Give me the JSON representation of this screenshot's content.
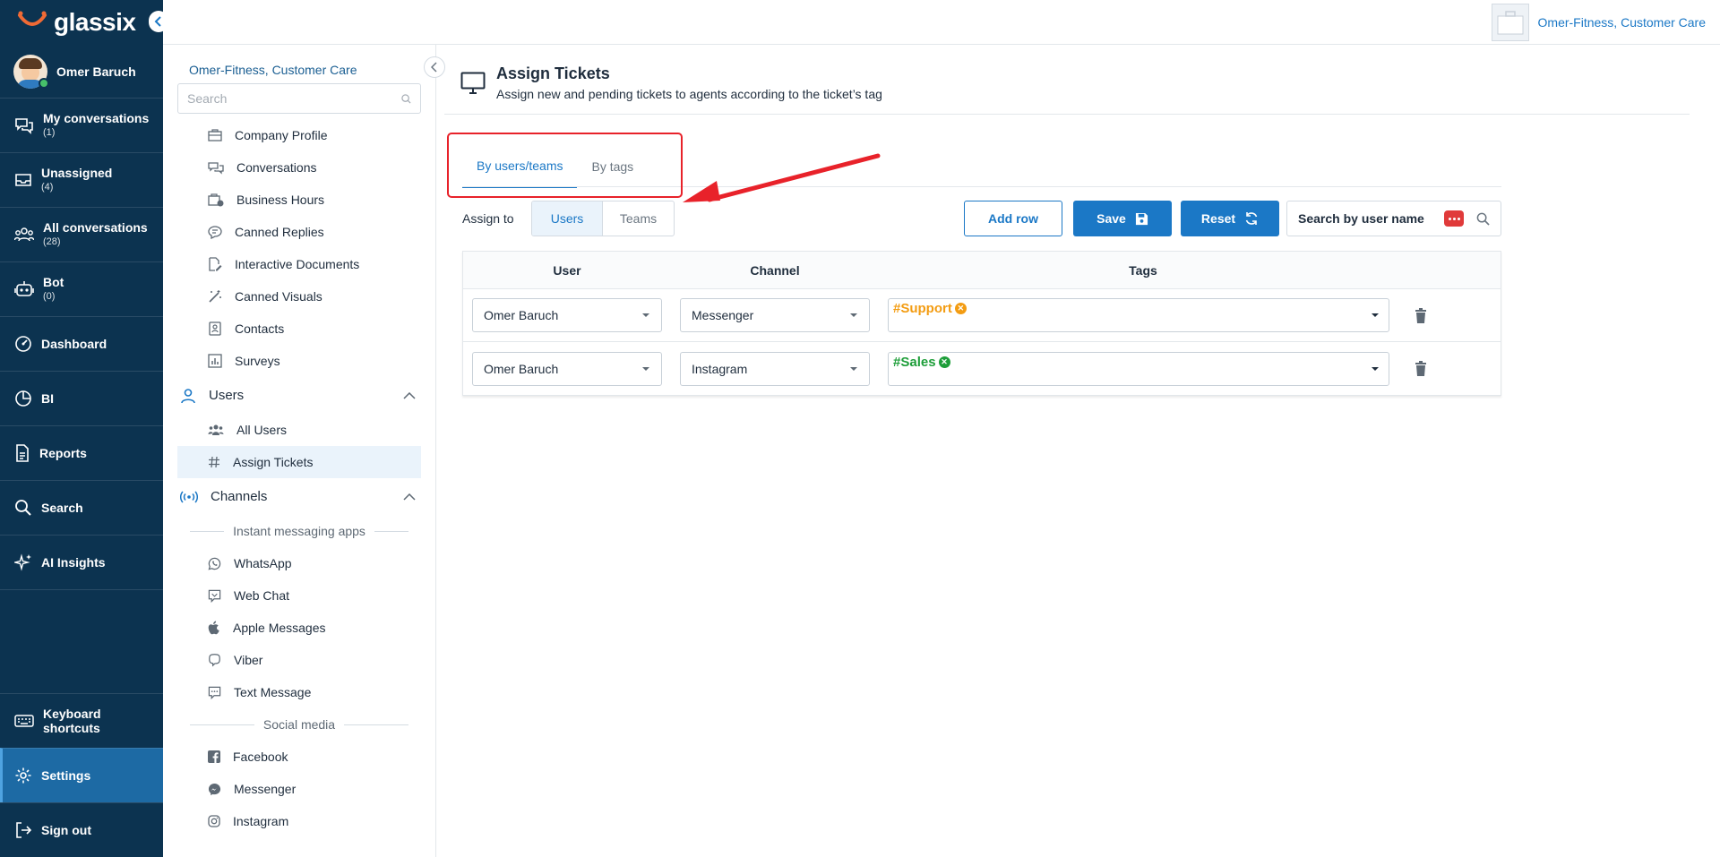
{
  "app": {
    "brand": "glassix"
  },
  "colors": {
    "nav_bg": "#0c3350",
    "accent": "#1b78c6",
    "support_tag": "#f39c12",
    "sales_tag": "#1e9e3a",
    "highlight": "#e8222a"
  },
  "profile": {
    "name": "Omer Baruch"
  },
  "nav": {
    "items": [
      {
        "label": "My conversations",
        "count": "(1)",
        "icon": "chat-bubbles-icon"
      },
      {
        "label": "Unassigned",
        "count": "(4)",
        "icon": "inbox-icon"
      },
      {
        "label": "All conversations",
        "count": "(28)",
        "icon": "group-icon"
      },
      {
        "label": "Bot",
        "count": "(0)",
        "icon": "robot-icon"
      },
      {
        "label": "Dashboard",
        "count": "",
        "icon": "dashboard-icon"
      },
      {
        "label": "BI",
        "count": "",
        "icon": "pie-chart-icon"
      },
      {
        "label": "Reports",
        "count": "",
        "icon": "report-icon"
      },
      {
        "label": "Search",
        "count": "",
        "icon": "search-icon"
      },
      {
        "label": "AI Insights",
        "count": "",
        "icon": "sparkle-icon"
      }
    ],
    "bottom": [
      {
        "label": "Keyboard shortcuts",
        "icon": "keyboard-icon"
      },
      {
        "label": "Settings",
        "icon": "gear-icon"
      },
      {
        "label": "Sign out",
        "icon": "sign-out-icon"
      }
    ]
  },
  "header": {
    "org_name": "Omer-Fitness, Customer Care"
  },
  "settings": {
    "org_name": "Omer-Fitness, Customer Care",
    "search_placeholder": "Search",
    "items": [
      {
        "label": "Company Profile"
      },
      {
        "label": "Conversations"
      },
      {
        "label": "Business Hours"
      },
      {
        "label": "Canned Replies"
      },
      {
        "label": "Interactive Documents"
      },
      {
        "label": "Canned Visuals"
      },
      {
        "label": "Contacts"
      },
      {
        "label": "Surveys"
      }
    ],
    "users_group": {
      "label": "Users",
      "items": [
        {
          "label": "All Users"
        },
        {
          "label": "Assign Tickets"
        }
      ]
    },
    "channels_group": {
      "label": "Channels",
      "im_divider": "Instant messaging apps",
      "im_items": [
        {
          "label": "WhatsApp"
        },
        {
          "label": "Web Chat"
        },
        {
          "label": "Apple Messages"
        },
        {
          "label": "Viber"
        },
        {
          "label": "Text Message"
        }
      ],
      "social_divider": "Social media",
      "social_items": [
        {
          "label": "Facebook"
        },
        {
          "label": "Messenger"
        },
        {
          "label": "Instagram"
        }
      ]
    }
  },
  "main": {
    "title": "Assign Tickets",
    "subtitle": "Assign new and pending tickets to agents according to the ticket’s tag",
    "tabs": [
      {
        "label": "By users/teams",
        "active": true
      },
      {
        "label": "By tags",
        "active": false
      }
    ],
    "assign_to_label": "Assign to",
    "seg_users": "Users",
    "seg_teams": "Teams",
    "add_row": "Add row",
    "save": "Save",
    "reset": "Reset",
    "search_user": "Search by user name",
    "table": {
      "headers": {
        "user": "User",
        "channel": "Channel",
        "tags": "Tags"
      },
      "rows": [
        {
          "user": "Omer Baruch",
          "channel": "Messenger",
          "tag": "#Support"
        },
        {
          "user": "Omer Baruch",
          "channel": "Instagram",
          "tag": "#Sales"
        }
      ]
    }
  }
}
